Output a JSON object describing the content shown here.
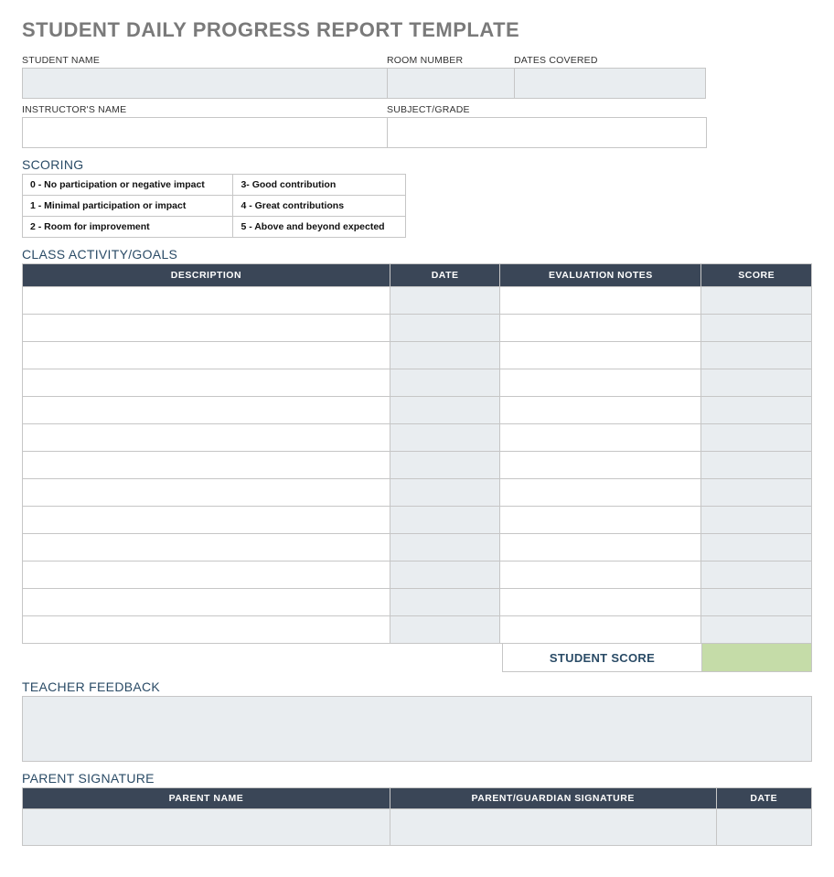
{
  "title": "STUDENT DAILY PROGRESS REPORT TEMPLATE",
  "fields": {
    "student_name": {
      "label": "STUDENT NAME",
      "value": ""
    },
    "room_number": {
      "label": "ROOM NUMBER",
      "value": ""
    },
    "dates_covered": {
      "label": "DATES COVERED",
      "value": ""
    },
    "instructor_name": {
      "label": "INSTRUCTOR'S NAME",
      "value": ""
    },
    "subject_grade": {
      "label": "SUBJECT/GRADE",
      "value": ""
    }
  },
  "scoring": {
    "heading": "SCORING",
    "legend": [
      [
        "0 - No participation or negative impact",
        "3- Good contribution"
      ],
      [
        "1 - Minimal participation or impact",
        "4 - Great contributions"
      ],
      [
        "2 - Room for improvement",
        "5 - Above and beyond expected"
      ]
    ]
  },
  "goals": {
    "heading": "CLASS ACTIVITY/GOALS",
    "headers": {
      "description": "DESCRIPTION",
      "date": "DATE",
      "evaluation_notes": "EVALUATION NOTES",
      "score": "SCORE"
    },
    "row_count": 13,
    "rows": [
      {
        "description": "",
        "date": "",
        "evaluation_notes": "",
        "score": ""
      },
      {
        "description": "",
        "date": "",
        "evaluation_notes": "",
        "score": ""
      },
      {
        "description": "",
        "date": "",
        "evaluation_notes": "",
        "score": ""
      },
      {
        "description": "",
        "date": "",
        "evaluation_notes": "",
        "score": ""
      },
      {
        "description": "",
        "date": "",
        "evaluation_notes": "",
        "score": ""
      },
      {
        "description": "",
        "date": "",
        "evaluation_notes": "",
        "score": ""
      },
      {
        "description": "",
        "date": "",
        "evaluation_notes": "",
        "score": ""
      },
      {
        "description": "",
        "date": "",
        "evaluation_notes": "",
        "score": ""
      },
      {
        "description": "",
        "date": "",
        "evaluation_notes": "",
        "score": ""
      },
      {
        "description": "",
        "date": "",
        "evaluation_notes": "",
        "score": ""
      },
      {
        "description": "",
        "date": "",
        "evaluation_notes": "",
        "score": ""
      },
      {
        "description": "",
        "date": "",
        "evaluation_notes": "",
        "score": ""
      },
      {
        "description": "",
        "date": "",
        "evaluation_notes": "",
        "score": ""
      }
    ]
  },
  "student_score": {
    "label": "STUDENT SCORE",
    "value": ""
  },
  "teacher_feedback": {
    "heading": "TEACHER FEEDBACK",
    "value": ""
  },
  "parent_signature": {
    "heading": "PARENT SIGNATURE",
    "headers": {
      "parent_name": "PARENT NAME",
      "signature": "PARENT/GUARDIAN SIGNATURE",
      "date": "DATE"
    },
    "row": {
      "parent_name": "",
      "signature": "",
      "date": ""
    }
  }
}
